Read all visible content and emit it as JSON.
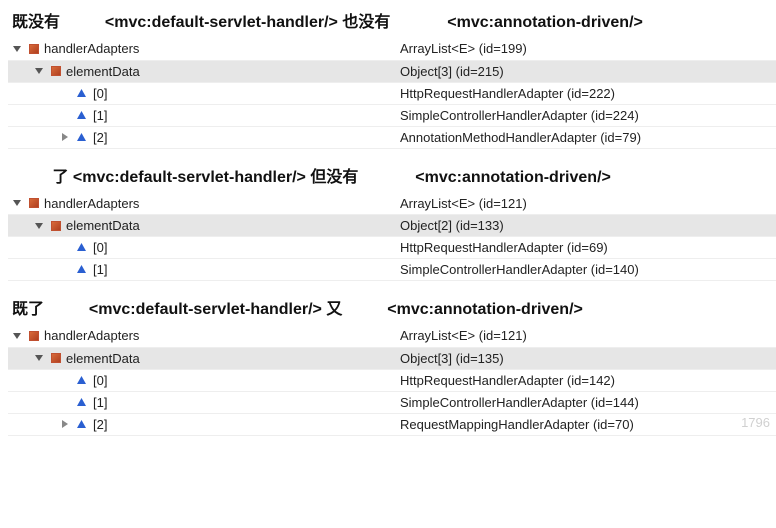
{
  "sections": [
    {
      "caption": {
        "pre": "既没有",
        "tag1": "<mvc:default-servlet-handler/>",
        "mid": "也没有",
        "tag2": "<mvc:annotation-driven/>"
      },
      "rows": [
        {
          "indent": 0,
          "twisty": "open",
          "icon": "sq",
          "name": "handlerAdapters",
          "value": "ArrayList<E>  (id=199)",
          "shade": false
        },
        {
          "indent": 1,
          "twisty": "open",
          "icon": "sq",
          "name": "elementData",
          "value": "Object[3]  (id=215)",
          "shade": true
        },
        {
          "indent": 2,
          "twisty": "none",
          "icon": "tri",
          "name": "[0]",
          "value": "HttpRequestHandlerAdapter  (id=222)",
          "shade": false
        },
        {
          "indent": 2,
          "twisty": "none",
          "icon": "tri",
          "name": "[1]",
          "value": "SimpleControllerHandlerAdapter  (id=224)",
          "shade": false
        },
        {
          "indent": 2,
          "twisty": "closed",
          "icon": "tri",
          "name": "[2]",
          "value": "AnnotationMethodHandlerAdapter  (id=79)",
          "shade": false
        }
      ]
    },
    {
      "caption": {
        "pre": "了",
        "tag1": "<mvc:default-servlet-handler/>",
        "mid": "但没有",
        "tag2": "<mvc:annotation-driven/>"
      },
      "rows": [
        {
          "indent": 0,
          "twisty": "open",
          "icon": "sq",
          "name": "handlerAdapters",
          "value": "ArrayList<E>  (id=121)",
          "shade": false
        },
        {
          "indent": 1,
          "twisty": "open",
          "icon": "sq",
          "name": "elementData",
          "value": "Object[2]  (id=133)",
          "shade": true
        },
        {
          "indent": 2,
          "twisty": "none",
          "icon": "tri",
          "name": "[0]",
          "value": "HttpRequestHandlerAdapter  (id=69)",
          "shade": false
        },
        {
          "indent": 2,
          "twisty": "none",
          "icon": "tri",
          "name": "[1]",
          "value": "SimpleControllerHandlerAdapter  (id=140)",
          "shade": false
        }
      ]
    },
    {
      "caption": {
        "pre": "既了",
        "tag1": "<mvc:default-servlet-handler/>",
        "mid": "又",
        "tag2": "<mvc:annotation-driven/>"
      },
      "rows": [
        {
          "indent": 0,
          "twisty": "open",
          "icon": "sq",
          "name": "handlerAdapters",
          "value": "ArrayList<E>  (id=121)",
          "shade": false
        },
        {
          "indent": 1,
          "twisty": "open",
          "icon": "sq",
          "name": "elementData",
          "value": "Object[3]  (id=135)",
          "shade": true
        },
        {
          "indent": 2,
          "twisty": "none",
          "icon": "tri",
          "name": "[0]",
          "value": "HttpRequestHandlerAdapter  (id=142)",
          "shade": false
        },
        {
          "indent": 2,
          "twisty": "none",
          "icon": "tri",
          "name": "[1]",
          "value": "SimpleControllerHandlerAdapter  (id=144)",
          "shade": false
        },
        {
          "indent": 2,
          "twisty": "closed",
          "icon": "tri",
          "name": "[2]",
          "value": "RequestMappingHandlerAdapter  (id=70)",
          "shade": false
        }
      ]
    }
  ],
  "watermark": "1796"
}
